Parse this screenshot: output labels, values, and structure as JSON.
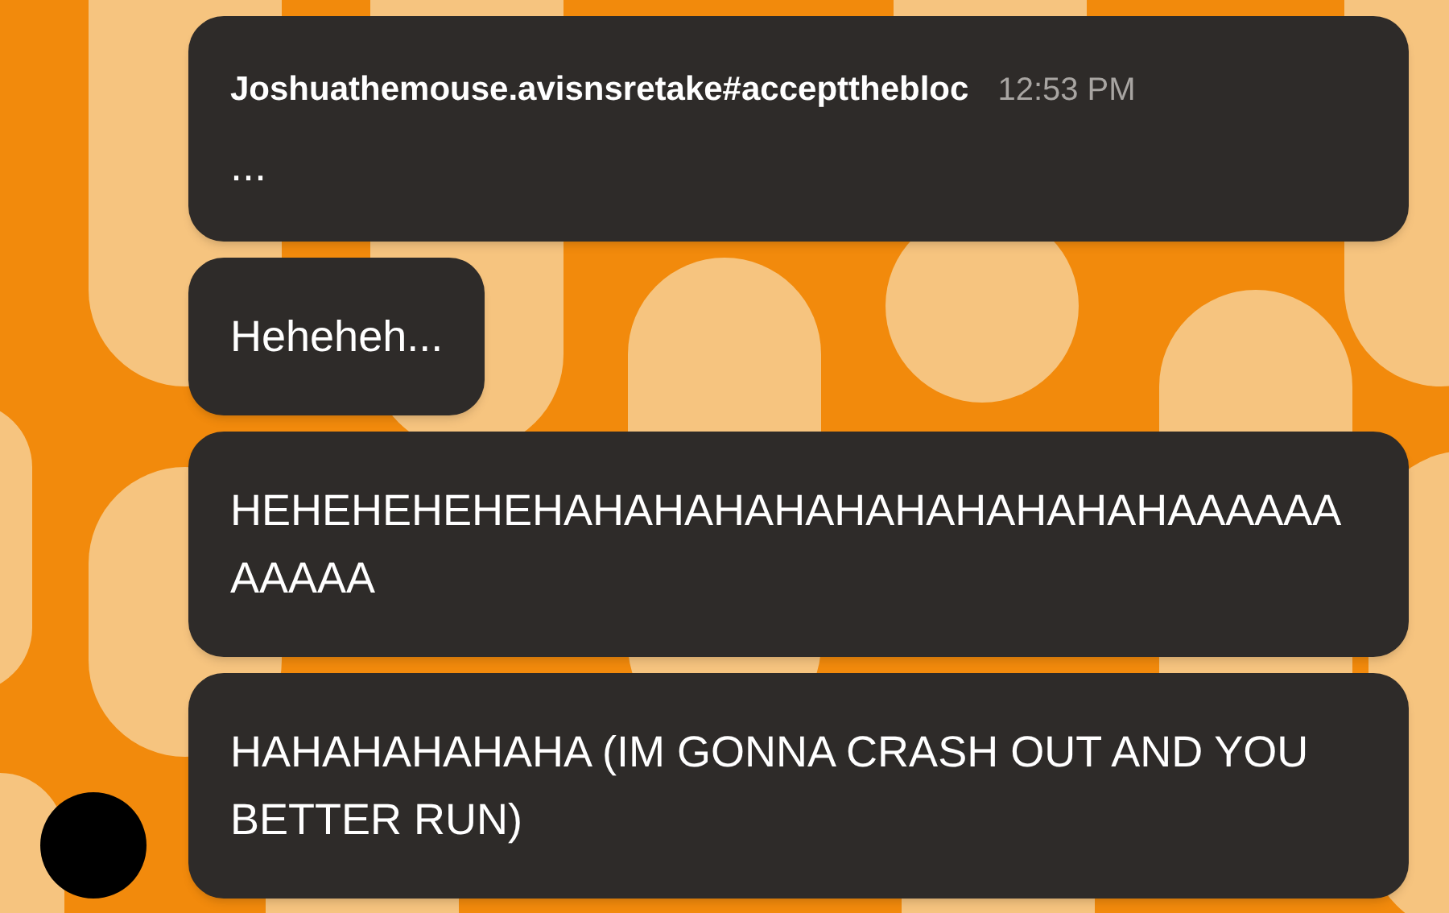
{
  "messages": [
    {
      "author": "Joshuathemouse.avisnsretake#acceptthebloc",
      "time": "12:53 PM",
      "text": "..."
    },
    {
      "text": "Heheheh..."
    },
    {
      "text": "HEHEHEHEHEHAHAHAHAHAHAHAHAHAHAHAAAAAAAAAAA"
    },
    {
      "text": "HAHAHAHAHAHA (IM GONNA CRASH OUT AND YOU BETTER RUN)",
      "avatar": true
    }
  ]
}
